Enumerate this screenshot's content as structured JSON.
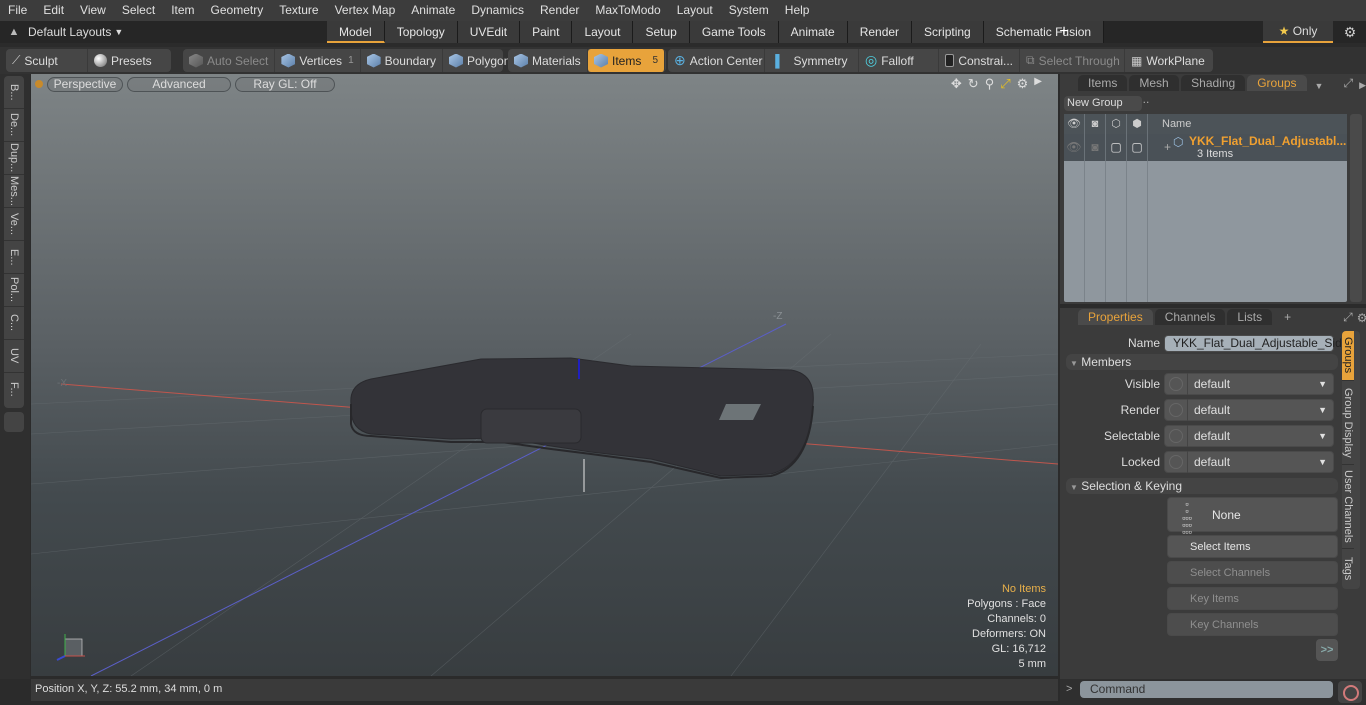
{
  "menu": [
    "File",
    "Edit",
    "View",
    "Select",
    "Item",
    "Geometry",
    "Texture",
    "Vertex Map",
    "Animate",
    "Dynamics",
    "Render",
    "MaxToModo",
    "Layout",
    "System",
    "Help"
  ],
  "layout_bar": {
    "layouts_dropdown": "Default Layouts",
    "tabs": [
      "Model",
      "Topology",
      "UVEdit",
      "Paint",
      "Layout",
      "Setup",
      "Game Tools",
      "Animate",
      "Render",
      "Scripting",
      "Schematic Fusion"
    ],
    "active_tab": "Model",
    "add_tab": "+",
    "only_label": "Only"
  },
  "toolbar": {
    "sculpt": "Sculpt",
    "presets": "Presets",
    "auto_select": "Auto Select",
    "vertices": "Vertices",
    "vertices_count": "1",
    "boundary": "Boundary",
    "polygons": "Polygons",
    "materials": "Materials",
    "items": "Items",
    "items_count": "5",
    "action_center": "Action Center",
    "symmetry": "Symmetry",
    "falloff": "Falloff",
    "constraints": "Constrai...",
    "select_through": "Select Through",
    "workplane": "WorkPlane"
  },
  "left_tabs": [
    "B...",
    "De...",
    "Dup...",
    "Mes...",
    "Ve...",
    "E...",
    "Pol...",
    "C...",
    "UV",
    "F..."
  ],
  "viewport": {
    "view": "Perspective",
    "shading": "Advanced",
    "raygl": "Ray GL: Off",
    "axis_neg_z": "-Z",
    "axis_neg_x": "-X",
    "info": {
      "items": "No Items",
      "polygons": "Polygons : Face",
      "channels": "Channels: 0",
      "deformers": "Deformers: ON",
      "gl": "GL: 16,712",
      "scale": "5 mm"
    }
  },
  "status": {
    "position": "Position X, Y, Z:   55.2 mm, 34 mm, 0 m"
  },
  "groups_panel": {
    "tabs": [
      "Items",
      "Mesh ...",
      "Shading",
      "Groups"
    ],
    "active_tab": "Groups",
    "new_group": "New Group",
    "column_name": "Name",
    "group": {
      "name": "YKK_Flat_Dual_Adjustabl...",
      "count": "3 Items"
    }
  },
  "properties_panel": {
    "tabs": [
      "Properties",
      "Channels",
      "Lists",
      "+"
    ],
    "active_tab": "Properties",
    "name_label": "Name",
    "name_value": "YKK_Flat_Dual_Adjustable_Side_",
    "members_section": "Members",
    "fields": [
      {
        "label": "Visible",
        "value": "default"
      },
      {
        "label": "Render",
        "value": "default"
      },
      {
        "label": "Selectable",
        "value": "default"
      },
      {
        "label": "Locked",
        "value": "default"
      }
    ],
    "selection_section": "Selection & Keying",
    "none_label": "None",
    "buttons": [
      "Select Items",
      "Select Channels",
      "Key Items",
      "Key Channels"
    ],
    "more": ">>",
    "side_tabs": [
      "Groups",
      "Group Display",
      "User Channels",
      "Tags"
    ]
  },
  "command": {
    "prompt": ">",
    "placeholder": "Command"
  },
  "colors": {
    "accent": "#e8a33b",
    "group_name": "#f0a030"
  }
}
